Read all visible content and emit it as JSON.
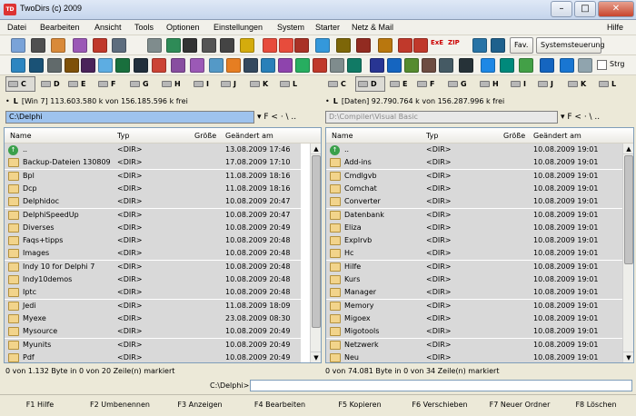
{
  "window": {
    "title": "TwoDirs (c) 2009",
    "minimize": "–",
    "maximize": "□",
    "close": "✕"
  },
  "menu": [
    "Datei",
    "Bearbeiten",
    "Ansicht",
    "Tools",
    "Optionen",
    "Einstellungen",
    "System",
    "Starter",
    "Netz & Mail",
    "Hilfe"
  ],
  "toolbar1": {
    "icons": [
      "explorer-icon",
      "binoculars-icon",
      "new-window-icon",
      "list-icon",
      "tree-icon",
      "split-icon",
      "copy-icon",
      "arrows-icon",
      "equals-icon",
      "compare-icon",
      "network-icon",
      "tools-icon",
      "archive-icon",
      "exe-zip-icon",
      "pc-icon"
    ],
    "exe_label": "ExE",
    "zip_label": "ZIP",
    "fav_label": "Fav.",
    "control_panel_label": "Systemsteuerung"
  },
  "toolbar2": {
    "checkbox_label": "Strg"
  },
  "left": {
    "drives": [
      "C",
      "D",
      "E",
      "F",
      "G",
      "H",
      "I",
      "J",
      "K",
      "L"
    ],
    "active_drive": "C",
    "info_label": "L",
    "info_text": "[Win 7] 113.603.580 k von 156.185.596 k frei",
    "path": "C:\\Delphi",
    "nav": "▾ F < · \\ ..",
    "columns": {
      "name": "Name",
      "type": "Typ",
      "size": "Größe",
      "modified": "Geändert am"
    },
    "rows": [
      {
        "name": "..",
        "type": "<DIR>",
        "date": "13.08.2009 17:46"
      },
      {
        "name": "Backup-Dateien 130809",
        "type": "<DIR>",
        "date": "17.08.2009 17:10"
      },
      {
        "name": "Bpl",
        "type": "<DIR>",
        "date": "11.08.2009 18:16"
      },
      {
        "name": "Dcp",
        "type": "<DIR>",
        "date": "11.08.2009 18:16"
      },
      {
        "name": "Delphidoc",
        "type": "<DIR>",
        "date": "10.08.2009 20:47"
      },
      {
        "name": "DelphiSpeedUp",
        "type": "<DIR>",
        "date": "10.08.2009 20:47"
      },
      {
        "name": "Diverses",
        "type": "<DIR>",
        "date": "10.08.2009 20:49"
      },
      {
        "name": "Faqs+tipps",
        "type": "<DIR>",
        "date": "10.08.2009 20:48"
      },
      {
        "name": "Images",
        "type": "<DIR>",
        "date": "10.08.2009 20:48"
      },
      {
        "name": "Indy 10 for Delphi 7",
        "type": "<DIR>",
        "date": "10.08.2009 20:48"
      },
      {
        "name": "Indy10demos",
        "type": "<DIR>",
        "date": "10.08.2009 20:48"
      },
      {
        "name": "Iptc",
        "type": "<DIR>",
        "date": "10.08.2009 20:48"
      },
      {
        "name": "Jedi",
        "type": "<DIR>",
        "date": "11.08.2009 18:09"
      },
      {
        "name": "Myexe",
        "type": "<DIR>",
        "date": "23.08.2009 08:30"
      },
      {
        "name": "Mysource",
        "type": "<DIR>",
        "date": "10.08.2009 20:49"
      },
      {
        "name": "Myunits",
        "type": "<DIR>",
        "date": "10.08.2009 20:49"
      },
      {
        "name": "Pdf",
        "type": "<DIR>",
        "date": "10.08.2009 20:49"
      }
    ],
    "status": "0 von 1.132 Byte in 0 von 20 Zeile(n) markiert"
  },
  "right": {
    "drives": [
      "C",
      "D",
      "E",
      "F",
      "G",
      "H",
      "I",
      "J",
      "K",
      "L"
    ],
    "active_drive": "D",
    "info_label": "L",
    "info_text": "[Daten] 92.790.764 k von 156.287.996 k frei",
    "path": "D:\\Compiler\\Visual Basic",
    "nav": "▾ F < · \\ ..",
    "columns": {
      "name": "Name",
      "type": "Typ",
      "size": "Größe",
      "modified": "Geändert am"
    },
    "rows": [
      {
        "name": "..",
        "type": "<DIR>",
        "date": "10.08.2009 19:01"
      },
      {
        "name": "Add-ins",
        "type": "<DIR>",
        "date": "10.08.2009 19:01"
      },
      {
        "name": "Cmdlgvb",
        "type": "<DIR>",
        "date": "10.08.2009 19:01"
      },
      {
        "name": "Comchat",
        "type": "<DIR>",
        "date": "10.08.2009 19:01"
      },
      {
        "name": "Converter",
        "type": "<DIR>",
        "date": "10.08.2009 19:01"
      },
      {
        "name": "Datenbank",
        "type": "<DIR>",
        "date": "10.08.2009 19:01"
      },
      {
        "name": "Eliza",
        "type": "<DIR>",
        "date": "10.08.2009 19:01"
      },
      {
        "name": "Explrvb",
        "type": "<DIR>",
        "date": "10.08.2009 19:01"
      },
      {
        "name": "Hc",
        "type": "<DIR>",
        "date": "10.08.2009 19:01"
      },
      {
        "name": "Hilfe",
        "type": "<DIR>",
        "date": "10.08.2009 19:01"
      },
      {
        "name": "Kurs",
        "type": "<DIR>",
        "date": "10.08.2009 19:01"
      },
      {
        "name": "Manager",
        "type": "<DIR>",
        "date": "10.08.2009 19:01"
      },
      {
        "name": "Memory",
        "type": "<DIR>",
        "date": "10.08.2009 19:01"
      },
      {
        "name": "Migoex",
        "type": "<DIR>",
        "date": "10.08.2009 19:01"
      },
      {
        "name": "Migotools",
        "type": "<DIR>",
        "date": "10.08.2009 19:01"
      },
      {
        "name": "Netzwerk",
        "type": "<DIR>",
        "date": "10.08.2009 19:01"
      },
      {
        "name": "Neu",
        "type": "<DIR>",
        "date": "10.08.2009 19:01"
      }
    ],
    "status": "0 von 74.081 Byte in 0 von 34 Zeile(n) markiert"
  },
  "command": {
    "label": "C:\\Delphi>",
    "value": ""
  },
  "fkeys": [
    "F1 Hilfe",
    "F2 Umbenennen",
    "F3 Anzeigen",
    "F4 Bearbeiten",
    "F5 Kopieren",
    "F6 Verschieben",
    "F7 Neuer Ordner",
    "F8 Löschen"
  ]
}
